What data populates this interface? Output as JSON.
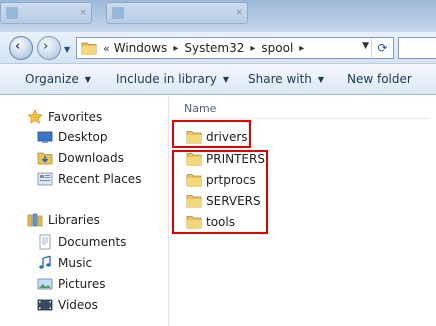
{
  "address": {
    "prefix": "«",
    "crumbs": [
      "Windows",
      "System32",
      "spool"
    ]
  },
  "toolbar": {
    "organize": "Organize",
    "include": "Include in library",
    "share": "Share with",
    "newfolder": "New folder"
  },
  "nav": {
    "favorites": "Favorites",
    "desktop": "Desktop",
    "downloads": "Downloads",
    "recent": "Recent Places",
    "libraries": "Libraries",
    "documents": "Documents",
    "music": "Music",
    "pictures": "Pictures",
    "videos": "Videos"
  },
  "content": {
    "column_name": "Name",
    "folders": [
      "drivers",
      "PRINTERS",
      "prtprocs",
      "SERVERS",
      "tools"
    ]
  },
  "colors": {
    "highlight": "#e30000",
    "folder": "#e8c25a"
  }
}
